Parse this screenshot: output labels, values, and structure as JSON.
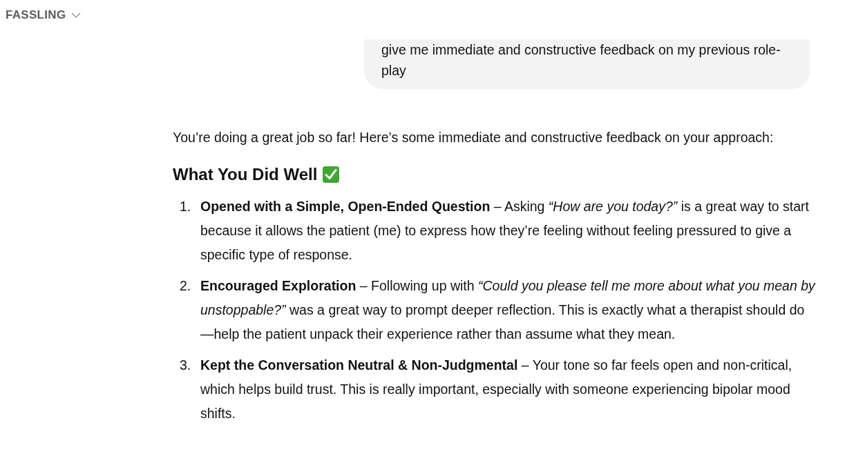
{
  "header": {
    "title": "FASSLING"
  },
  "user_message": {
    "text": "give me immediate and constructive feedback on my previous role-play"
  },
  "reply": {
    "intro": "You’re doing a great job so far! Here’s some immediate and constructive feedback on your approach:",
    "heading": "What You Did Well",
    "items": [
      {
        "number": "1.",
        "text": "**Opened with a Simple, Open-Ended Question** – Asking *“How are you today?”* is a great way to start because it allows the patient (me) to express how they’re feeling without feeling pressured to give a specific type of response."
      },
      {
        "number": "2.",
        "text": "**Encouraged Exploration** – Following up with *“Could you please tell me more about what you mean by unstoppable?”* was a great way to prompt deeper reflection. This is exactly what a therapist should do—help the patient unpack their experience rather than assume what they mean."
      },
      {
        "number": "3.",
        "text": "**Kept the Conversation Neutral & Non-Judgmental** – Your tone so far feels open and non-critical, which helps build trust. This is really important, especially with someone experiencing bipolar mood shifts."
      }
    ]
  }
}
